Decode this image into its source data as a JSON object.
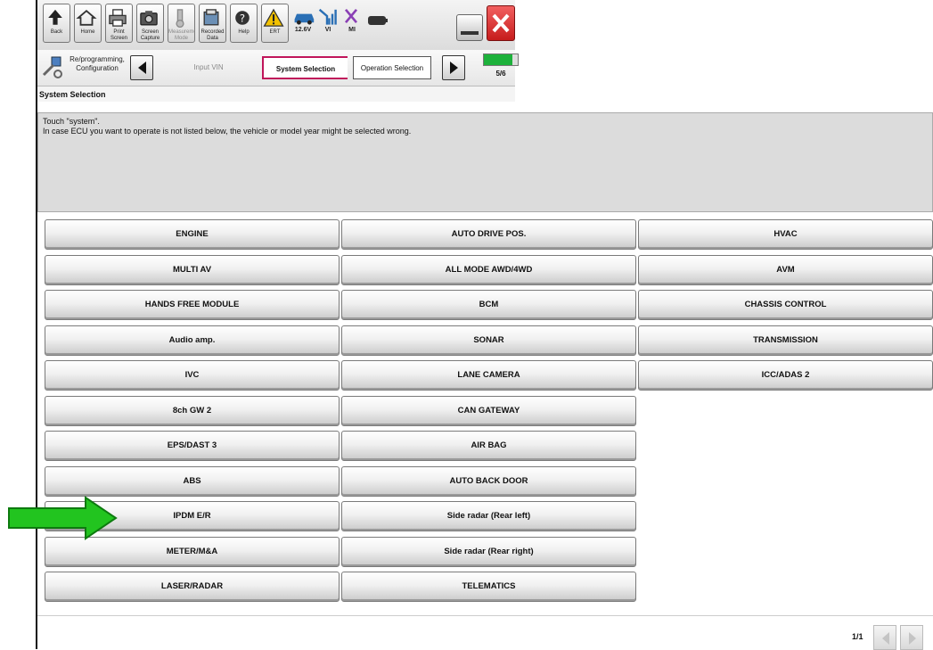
{
  "toolbar": {
    "back": "Back",
    "home": "Home",
    "print_screen": "Print Screen",
    "screen_capture": "Screen Capture",
    "measurement_mode": "Measurement Mode",
    "recorded_data": "Recorded Data",
    "help": "Help",
    "ert": "ERT",
    "voltage": "12.6V",
    "vi": "VI",
    "mi": "MI"
  },
  "nav": {
    "reprog_label": "Re/programming, Configuration",
    "crumbs": [
      "Input VIN",
      "System Selection",
      "Operation Selection"
    ],
    "progress_text": "5/6",
    "progress_fraction": 0.83
  },
  "page_title": "System Selection",
  "message": {
    "line1": "Touch \"system\".",
    "line2": "In case ECU you want to operate is not listed below, the vehicle or model year might be selected wrong."
  },
  "systems": {
    "col1": [
      "ENGINE",
      "MULTI AV",
      "HANDS FREE MODULE",
      "Audio amp.",
      "IVC",
      "8ch GW 2",
      "EPS/DAST 3",
      "ABS",
      "IPDM E/R",
      "METER/M&A",
      "LASER/RADAR"
    ],
    "col2": [
      "AUTO DRIVE POS.",
      "ALL MODE AWD/4WD",
      "BCM",
      "SONAR",
      "LANE CAMERA",
      "CAN GATEWAY",
      "AIR BAG",
      "AUTO BACK DOOR",
      "Side radar (Rear left)",
      "Side radar (Rear right)",
      "TELEMATICS"
    ],
    "col3": [
      "HVAC",
      "AVM",
      "CHASSIS CONTROL",
      "TRANSMISSION",
      "ICC/ADAS 2"
    ]
  },
  "pagination": {
    "indicator": "1/1"
  },
  "colors": {
    "highlight_arrow": "#22c41f",
    "active_crumb_border": "#c0155a",
    "close_button": "#d62828"
  }
}
